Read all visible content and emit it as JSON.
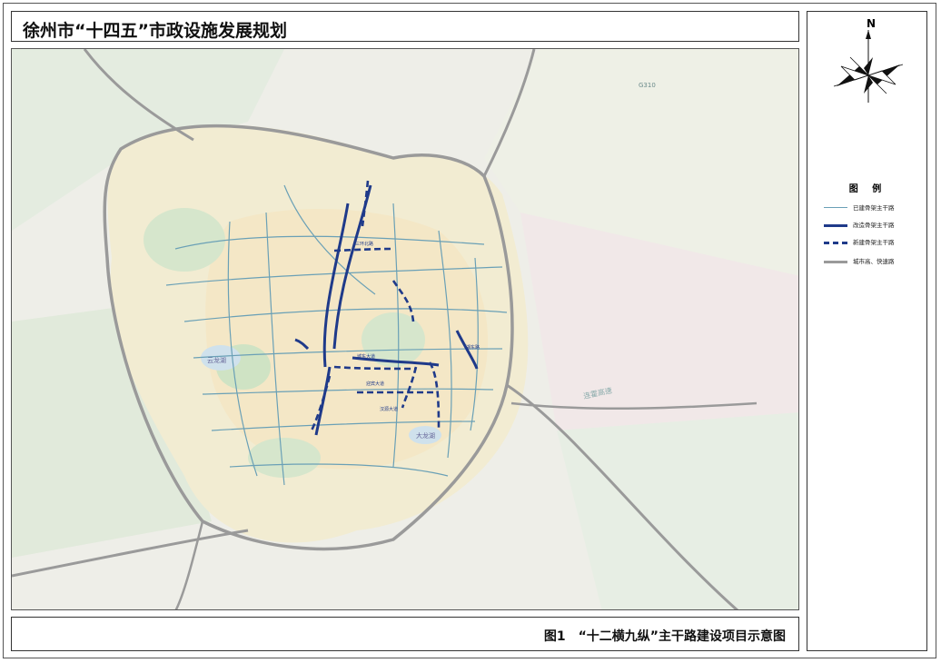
{
  "page_title": "徐州市“十四五”市政设施发展规划",
  "figure_caption": "图1　“十二横九纵”主干路建设项目示意图",
  "compass": {
    "label": "N",
    "icon": "north-arrow-icon"
  },
  "legend": {
    "title": "图 例",
    "items": [
      {
        "label": "已建骨架主干路",
        "color": "#6aa0b6",
        "style": "thin-solid"
      },
      {
        "label": "改造骨架主干路",
        "color": "#1f3a8a",
        "style": "thick-solid"
      },
      {
        "label": "新建骨架主干路",
        "color": "#1f3a8a",
        "style": "thick-dashed"
      },
      {
        "label": "城市高、快速路",
        "color": "#9a9a9a",
        "style": "thick-gray"
      }
    ]
  },
  "map_labels": {
    "road_1": "G310",
    "road_2": "连霍高速",
    "lake": "云龙湖",
    "lake_2": "大龙湖",
    "label_a": "三环北路",
    "label_b": "城东大道",
    "label_c": "湖东路",
    "label_d": "迎宾大道",
    "label_e": "汉源大道"
  },
  "colors": {
    "frame": "#333333",
    "map_bg": "#f3f3ef",
    "built_road": "#6aa0b6",
    "rebuilt_road": "#1f3a8a",
    "expressway": "#9a9a9a"
  }
}
